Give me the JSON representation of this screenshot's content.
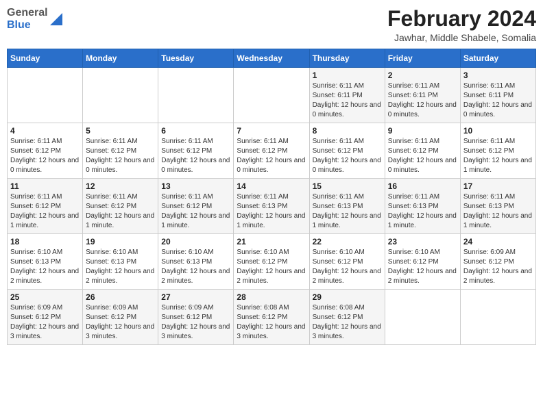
{
  "header": {
    "logo_general": "General",
    "logo_blue": "Blue",
    "month_year": "February 2024",
    "location": "Jawhar, Middle Shabele, Somalia"
  },
  "days_of_week": [
    "Sunday",
    "Monday",
    "Tuesday",
    "Wednesday",
    "Thursday",
    "Friday",
    "Saturday"
  ],
  "weeks": [
    [
      {
        "day": "",
        "info": ""
      },
      {
        "day": "",
        "info": ""
      },
      {
        "day": "",
        "info": ""
      },
      {
        "day": "",
        "info": ""
      },
      {
        "day": "1",
        "info": "Sunrise: 6:11 AM\nSunset: 6:11 PM\nDaylight: 12 hours and 0 minutes."
      },
      {
        "day": "2",
        "info": "Sunrise: 6:11 AM\nSunset: 6:11 PM\nDaylight: 12 hours and 0 minutes."
      },
      {
        "day": "3",
        "info": "Sunrise: 6:11 AM\nSunset: 6:11 PM\nDaylight: 12 hours and 0 minutes."
      }
    ],
    [
      {
        "day": "4",
        "info": "Sunrise: 6:11 AM\nSunset: 6:12 PM\nDaylight: 12 hours and 0 minutes."
      },
      {
        "day": "5",
        "info": "Sunrise: 6:11 AM\nSunset: 6:12 PM\nDaylight: 12 hours and 0 minutes."
      },
      {
        "day": "6",
        "info": "Sunrise: 6:11 AM\nSunset: 6:12 PM\nDaylight: 12 hours and 0 minutes."
      },
      {
        "day": "7",
        "info": "Sunrise: 6:11 AM\nSunset: 6:12 PM\nDaylight: 12 hours and 0 minutes."
      },
      {
        "day": "8",
        "info": "Sunrise: 6:11 AM\nSunset: 6:12 PM\nDaylight: 12 hours and 0 minutes."
      },
      {
        "day": "9",
        "info": "Sunrise: 6:11 AM\nSunset: 6:12 PM\nDaylight: 12 hours and 0 minutes."
      },
      {
        "day": "10",
        "info": "Sunrise: 6:11 AM\nSunset: 6:12 PM\nDaylight: 12 hours and 1 minute."
      }
    ],
    [
      {
        "day": "11",
        "info": "Sunrise: 6:11 AM\nSunset: 6:12 PM\nDaylight: 12 hours and 1 minute."
      },
      {
        "day": "12",
        "info": "Sunrise: 6:11 AM\nSunset: 6:12 PM\nDaylight: 12 hours and 1 minute."
      },
      {
        "day": "13",
        "info": "Sunrise: 6:11 AM\nSunset: 6:12 PM\nDaylight: 12 hours and 1 minute."
      },
      {
        "day": "14",
        "info": "Sunrise: 6:11 AM\nSunset: 6:13 PM\nDaylight: 12 hours and 1 minute."
      },
      {
        "day": "15",
        "info": "Sunrise: 6:11 AM\nSunset: 6:13 PM\nDaylight: 12 hours and 1 minute."
      },
      {
        "day": "16",
        "info": "Sunrise: 6:11 AM\nSunset: 6:13 PM\nDaylight: 12 hours and 1 minute."
      },
      {
        "day": "17",
        "info": "Sunrise: 6:11 AM\nSunset: 6:13 PM\nDaylight: 12 hours and 1 minute."
      }
    ],
    [
      {
        "day": "18",
        "info": "Sunrise: 6:10 AM\nSunset: 6:13 PM\nDaylight: 12 hours and 2 minutes."
      },
      {
        "day": "19",
        "info": "Sunrise: 6:10 AM\nSunset: 6:13 PM\nDaylight: 12 hours and 2 minutes."
      },
      {
        "day": "20",
        "info": "Sunrise: 6:10 AM\nSunset: 6:13 PM\nDaylight: 12 hours and 2 minutes."
      },
      {
        "day": "21",
        "info": "Sunrise: 6:10 AM\nSunset: 6:12 PM\nDaylight: 12 hours and 2 minutes."
      },
      {
        "day": "22",
        "info": "Sunrise: 6:10 AM\nSunset: 6:12 PM\nDaylight: 12 hours and 2 minutes."
      },
      {
        "day": "23",
        "info": "Sunrise: 6:10 AM\nSunset: 6:12 PM\nDaylight: 12 hours and 2 minutes."
      },
      {
        "day": "24",
        "info": "Sunrise: 6:09 AM\nSunset: 6:12 PM\nDaylight: 12 hours and 2 minutes."
      }
    ],
    [
      {
        "day": "25",
        "info": "Sunrise: 6:09 AM\nSunset: 6:12 PM\nDaylight: 12 hours and 3 minutes."
      },
      {
        "day": "26",
        "info": "Sunrise: 6:09 AM\nSunset: 6:12 PM\nDaylight: 12 hours and 3 minutes."
      },
      {
        "day": "27",
        "info": "Sunrise: 6:09 AM\nSunset: 6:12 PM\nDaylight: 12 hours and 3 minutes."
      },
      {
        "day": "28",
        "info": "Sunrise: 6:08 AM\nSunset: 6:12 PM\nDaylight: 12 hours and 3 minutes."
      },
      {
        "day": "29",
        "info": "Sunrise: 6:08 AM\nSunset: 6:12 PM\nDaylight: 12 hours and 3 minutes."
      },
      {
        "day": "",
        "info": ""
      },
      {
        "day": "",
        "info": ""
      }
    ]
  ]
}
